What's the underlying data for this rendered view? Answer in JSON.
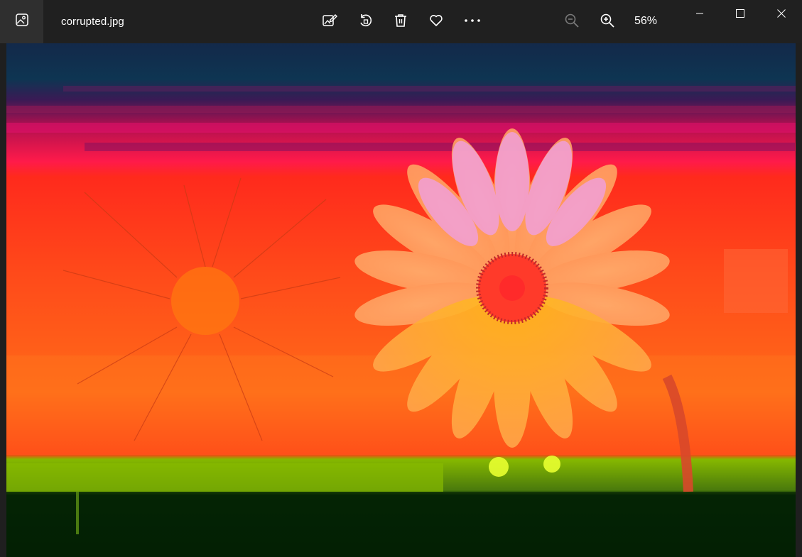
{
  "window": {
    "file_name": "corrupted.jpg",
    "zoom_level": "56%"
  },
  "toolbar": {
    "icons": [
      "photo-app-icon",
      "edit-image-icon",
      "rotate-icon",
      "delete-icon",
      "favorite-heart-icon",
      "more-options-icon",
      "zoom-out-icon",
      "zoom-in-icon"
    ]
  },
  "window_controls": [
    "minimize-icon",
    "maximize-icon",
    "close-icon"
  ],
  "colors": {
    "titlebar": "#202020",
    "icon_box": "#2f2f2f",
    "text": "#ffffff",
    "disabled_icon": "#7a7a7a"
  },
  "image": {
    "description_icon": "daisy-photo"
  }
}
